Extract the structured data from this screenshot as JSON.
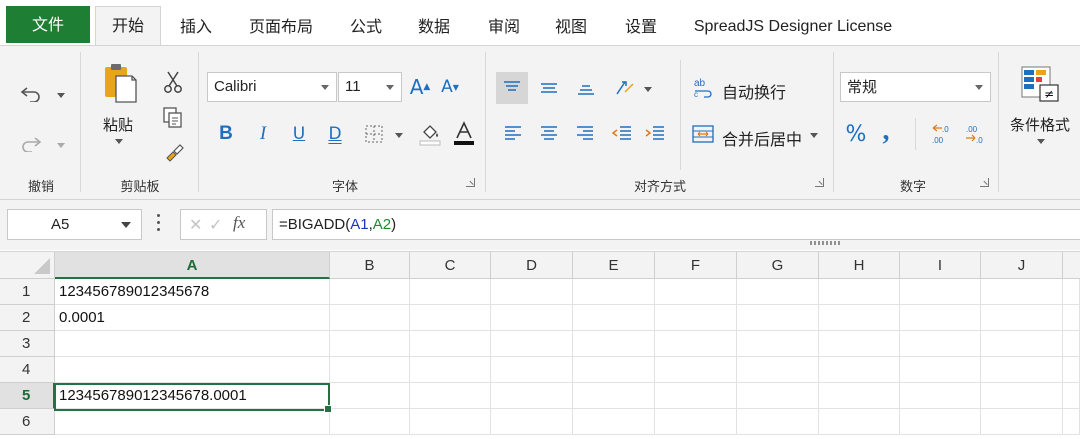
{
  "tabs": [
    {
      "label": "文件"
    },
    {
      "label": "开始"
    },
    {
      "label": "插入"
    },
    {
      "label": "页面布局"
    },
    {
      "label": "公式"
    },
    {
      "label": "数据"
    },
    {
      "label": "审阅"
    },
    {
      "label": "视图"
    },
    {
      "label": "设置"
    },
    {
      "label": "SpreadJS Designer License"
    }
  ],
  "ribbon": {
    "undo_group": {
      "label": "撤销"
    },
    "clipboard": {
      "label": "剪贴板",
      "paste_label": "粘贴"
    },
    "font": {
      "label": "字体",
      "family": "Calibri",
      "size": "11",
      "bold": "B",
      "italic": "I",
      "underline": "U",
      "double_underline": "D"
    },
    "alignment": {
      "label": "对齐方式",
      "wrap_text": "自动换行",
      "merge_center": "合并后居中"
    },
    "number": {
      "label": "数字",
      "format": "常规",
      "percent": "%",
      "comma": ","
    },
    "styles": {
      "conditional_format": "条件格式"
    }
  },
  "formula_bar": {
    "name_box": "A5",
    "formula_prefix": "=BIGADD(",
    "ref1": "A1",
    "sep": ",",
    "ref2": "A2",
    "formula_suffix": ")"
  },
  "grid": {
    "columns": [
      "A",
      "B",
      "C",
      "D",
      "E",
      "F",
      "G",
      "H",
      "I",
      "J"
    ],
    "rows": [
      "1",
      "2",
      "3",
      "4",
      "5",
      "6"
    ],
    "cells": {
      "A1": "123456789012345678",
      "A2": "0.0001",
      "A5": "123456789012345678.0001"
    },
    "selected_cell": "A5"
  },
  "colors": {
    "accent_green": "#217346",
    "file_tab": "#1e7e34",
    "ref1_color": "#1a35c7",
    "ref2_color": "#1e8a2e"
  }
}
